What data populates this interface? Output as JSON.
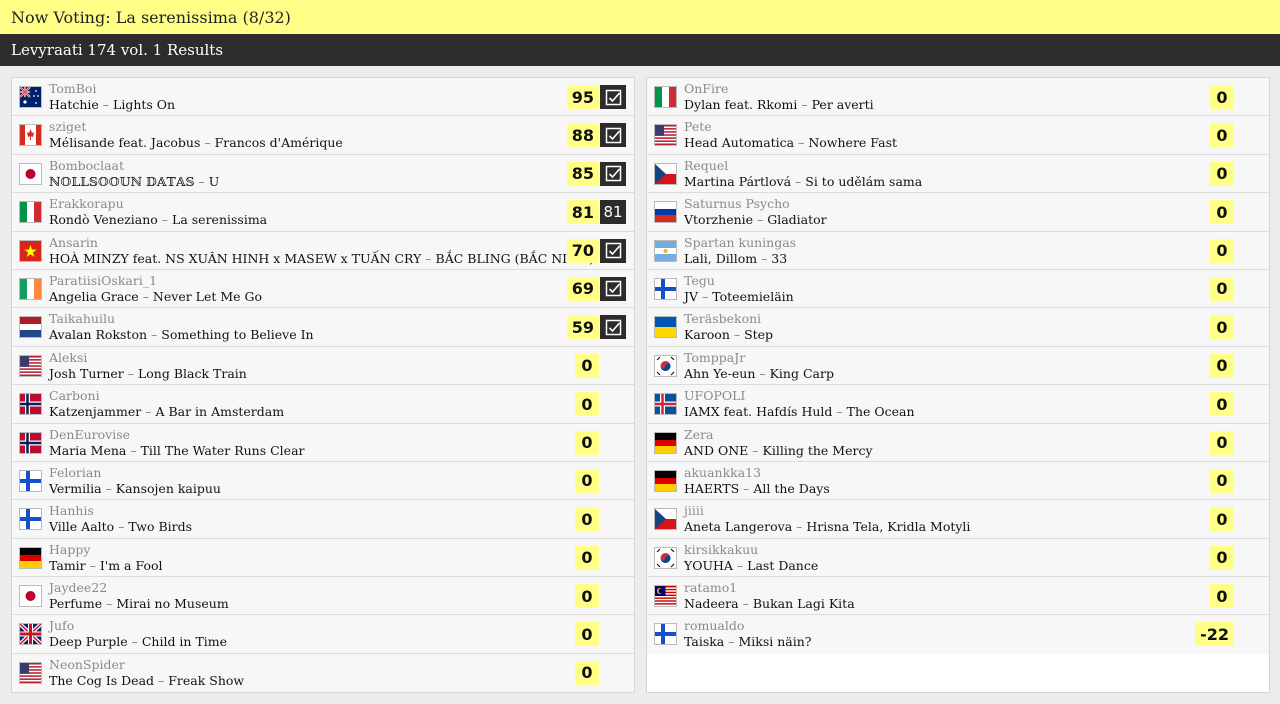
{
  "header": {
    "now_voting": "Now Voting: La serenissima (8/32)",
    "results_title": "Levyraati 174 vol. 1 Results"
  },
  "left": [
    {
      "user": "TomBoi",
      "artist": "Hatchie",
      "title": "Lights On",
      "score": "95",
      "badge": "check",
      "flag": "au"
    },
    {
      "user": "sziget",
      "artist": "Mélisande feat. Jacobus",
      "title": "Francos d'Amérique",
      "score": "88",
      "badge": "check",
      "flag": "ca"
    },
    {
      "user": "Bomboclaat",
      "artist": "ℕ𝕆𝕃𝕃𝕊𝕆𝕆𝕌ℕ 𝔻𝔸𝕋𝔸𝕊",
      "title": "U",
      "score": "85",
      "badge": "check",
      "flag": "jp"
    },
    {
      "user": "Erakkorapu",
      "artist": "Rondò Veneziano",
      "title": "La serenissima",
      "score": "81",
      "badge": "81",
      "flag": "it"
    },
    {
      "user": "Ansarin",
      "artist": "HOÀ MINZY feat. NS XUÂN HINH x MASEW x TUẤN CRY",
      "title": "BẮC BLING (BẮC NINH)",
      "score": "70",
      "badge": "check",
      "flag": "vn"
    },
    {
      "user": "ParatiisiOskari_1",
      "artist": "Angelia Grace",
      "title": "Never Let Me Go",
      "score": "69",
      "badge": "check",
      "flag": "ie"
    },
    {
      "user": "Taikahuilu",
      "artist": "Avalan Rokston",
      "title": "Something to Believe In",
      "score": "59",
      "badge": "check",
      "flag": "nl"
    },
    {
      "user": "Aleksi",
      "artist": "Josh Turner",
      "title": "Long Black Train",
      "score": "0",
      "badge": "",
      "flag": "us"
    },
    {
      "user": "Carboni",
      "artist": "Katzenjammer",
      "title": "A Bar in Amsterdam",
      "score": "0",
      "badge": "",
      "flag": "no"
    },
    {
      "user": "DenEurovise",
      "artist": "Maria Mena",
      "title": "Till The Water Runs Clear",
      "score": "0",
      "badge": "",
      "flag": "no"
    },
    {
      "user": "Felorian",
      "artist": "Vermilia",
      "title": "Kansojen kaipuu",
      "score": "0",
      "badge": "",
      "flag": "fi"
    },
    {
      "user": "Hanhis",
      "artist": "Ville Aalto",
      "title": "Two Birds",
      "score": "0",
      "badge": "",
      "flag": "fi"
    },
    {
      "user": "Happy",
      "artist": "Tamir",
      "title": "I'm a Fool",
      "score": "0",
      "badge": "",
      "flag": "de"
    },
    {
      "user": "Jaydee22",
      "artist": "Perfume",
      "title": "Mirai no Museum",
      "score": "0",
      "badge": "",
      "flag": "jp"
    },
    {
      "user": "Jufo",
      "artist": "Deep Purple",
      "title": "Child in Time",
      "score": "0",
      "badge": "",
      "flag": "gb"
    },
    {
      "user": "NeonSpider",
      "artist": "The Cog Is Dead",
      "title": "Freak Show",
      "score": "0",
      "badge": "",
      "flag": "us"
    }
  ],
  "right": [
    {
      "user": "OnFire",
      "artist": "Dylan feat. Rkomi",
      "title": "Per averti",
      "score": "0",
      "badge": "",
      "flag": "it"
    },
    {
      "user": "Pete",
      "artist": "Head Automatica",
      "title": "Nowhere Fast",
      "score": "0",
      "badge": "",
      "flag": "us"
    },
    {
      "user": "Requel",
      "artist": "Martina Pártlová",
      "title": "Si to udělám sama",
      "score": "0",
      "badge": "",
      "flag": "cz"
    },
    {
      "user": "Saturnus Psycho",
      "artist": "Vtorzhenie",
      "title": "Gladiator",
      "score": "0",
      "badge": "",
      "flag": "ru"
    },
    {
      "user": "Spartan kuningas",
      "artist": "Lali, Dillom",
      "title": "33",
      "score": "0",
      "badge": "",
      "flag": "ar"
    },
    {
      "user": "Tegu",
      "artist": "JV",
      "title": "Toteemieläin",
      "score": "0",
      "badge": "",
      "flag": "fi"
    },
    {
      "user": "Teräsbekoni",
      "artist": "Karoon",
      "title": "Step",
      "score": "0",
      "badge": "",
      "flag": "ua"
    },
    {
      "user": "TomppaJr",
      "artist": "Ahn Ye-eun",
      "title": "King Carp",
      "score": "0",
      "badge": "",
      "flag": "kr"
    },
    {
      "user": "UFOPOLI",
      "artist": "IAMX feat. Hafdís Huld",
      "title": "The Ocean",
      "score": "0",
      "badge": "",
      "flag": "is"
    },
    {
      "user": "Zera",
      "artist": "AND ONE",
      "title": "Killing the Mercy",
      "score": "0",
      "badge": "",
      "flag": "de"
    },
    {
      "user": "akuankka13",
      "artist": "HAERTS",
      "title": "All the Days",
      "score": "0",
      "badge": "",
      "flag": "de"
    },
    {
      "user": "jiiii",
      "artist": "Aneta Langerova",
      "title": "Hrisna Tela, Kridla Motyli",
      "score": "0",
      "badge": "",
      "flag": "cz"
    },
    {
      "user": "kirsikkakuu",
      "artist": "YOUHA",
      "title": "Last Dance",
      "score": "0",
      "badge": "",
      "flag": "kr"
    },
    {
      "user": "ratamo1",
      "artist": "Nadeera",
      "title": "Bukan Lagi Kita",
      "score": "0",
      "badge": "",
      "flag": "my"
    },
    {
      "user": "romualdo",
      "artist": "Taiska",
      "title": "Miksi näin?",
      "score": "-22",
      "badge": "",
      "flag": "fi"
    }
  ]
}
